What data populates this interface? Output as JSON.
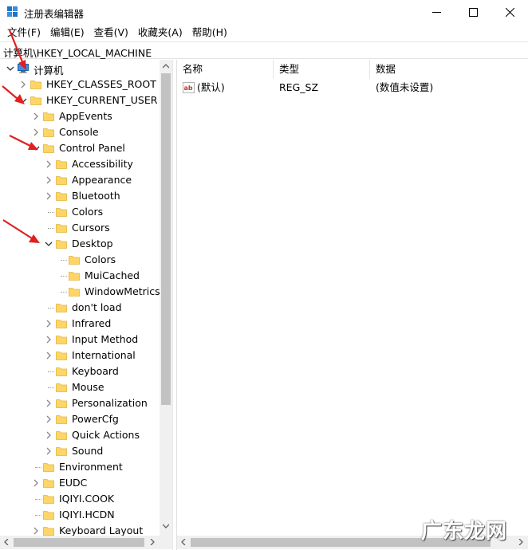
{
  "window": {
    "title": "注册表编辑器"
  },
  "menu": [
    "文件(F)",
    "编辑(E)",
    "查看(V)",
    "收藏夹(A)",
    "帮助(H)"
  ],
  "address": "计算机\\HKEY_LOCAL_MACHINE",
  "tree": [
    {
      "label": "计算机",
      "level": 0,
      "state": "expanded",
      "icon": "computer-icon"
    },
    {
      "label": "HKEY_CLASSES_ROOT",
      "level": 1,
      "state": "collapsed",
      "icon": "folder-icon"
    },
    {
      "label": "HKEY_CURRENT_USER",
      "level": 1,
      "state": "expanded",
      "icon": "folder-icon"
    },
    {
      "label": "AppEvents",
      "level": 2,
      "state": "collapsed",
      "icon": "folder-icon"
    },
    {
      "label": "Console",
      "level": 2,
      "state": "collapsed",
      "icon": "folder-icon"
    },
    {
      "label": "Control Panel",
      "level": 2,
      "state": "expanded",
      "icon": "folder-icon"
    },
    {
      "label": "Accessibility",
      "level": 3,
      "state": "collapsed",
      "icon": "folder-icon"
    },
    {
      "label": "Appearance",
      "level": 3,
      "state": "collapsed",
      "icon": "folder-icon"
    },
    {
      "label": "Bluetooth",
      "level": 3,
      "state": "collapsed",
      "icon": "folder-icon"
    },
    {
      "label": "Colors",
      "level": 3,
      "state": "leaf",
      "icon": "folder-icon"
    },
    {
      "label": "Cursors",
      "level": 3,
      "state": "leaf",
      "icon": "folder-icon"
    },
    {
      "label": "Desktop",
      "level": 3,
      "state": "expanded",
      "icon": "folder-icon"
    },
    {
      "label": "Colors",
      "level": 4,
      "state": "leaf",
      "icon": "folder-icon"
    },
    {
      "label": "MuiCached",
      "level": 4,
      "state": "leaf",
      "icon": "folder-icon"
    },
    {
      "label": "WindowMetrics",
      "level": 4,
      "state": "leaf",
      "icon": "folder-icon"
    },
    {
      "label": "don't load",
      "level": 3,
      "state": "leaf",
      "icon": "folder-icon"
    },
    {
      "label": "Infrared",
      "level": 3,
      "state": "collapsed",
      "icon": "folder-icon"
    },
    {
      "label": "Input Method",
      "level": 3,
      "state": "collapsed",
      "icon": "folder-icon"
    },
    {
      "label": "International",
      "level": 3,
      "state": "collapsed",
      "icon": "folder-icon"
    },
    {
      "label": "Keyboard",
      "level": 3,
      "state": "leaf",
      "icon": "folder-icon"
    },
    {
      "label": "Mouse",
      "level": 3,
      "state": "leaf",
      "icon": "folder-icon"
    },
    {
      "label": "Personalization",
      "level": 3,
      "state": "collapsed",
      "icon": "folder-icon"
    },
    {
      "label": "PowerCfg",
      "level": 3,
      "state": "collapsed",
      "icon": "folder-icon"
    },
    {
      "label": "Quick Actions",
      "level": 3,
      "state": "collapsed",
      "icon": "folder-icon"
    },
    {
      "label": "Sound",
      "level": 3,
      "state": "collapsed",
      "icon": "folder-icon"
    },
    {
      "label": "Environment",
      "level": 2,
      "state": "leaf",
      "icon": "folder-icon"
    },
    {
      "label": "EUDC",
      "level": 2,
      "state": "collapsed",
      "icon": "folder-icon"
    },
    {
      "label": "IQIYI.COOK",
      "level": 2,
      "state": "leaf",
      "icon": "folder-icon"
    },
    {
      "label": "IQIYI.HCDN",
      "level": 2,
      "state": "leaf",
      "icon": "folder-icon"
    },
    {
      "label": "Keyboard Layout",
      "level": 2,
      "state": "collapsed",
      "icon": "folder-icon"
    }
  ],
  "columns": {
    "name": "名称",
    "type": "类型",
    "data": "数据"
  },
  "values": [
    {
      "name": "(默认)",
      "type": "REG_SZ",
      "data": "(数值未设置)",
      "icon": "string-value-icon"
    }
  ],
  "watermark": "广东龙网",
  "colors": {
    "folder": "#ffd666",
    "folder_edge": "#e0b440",
    "annotation_arrow": "#e02020",
    "scroll_thumb": "#c2c2c2",
    "scroll_track": "#f0f0f0"
  }
}
